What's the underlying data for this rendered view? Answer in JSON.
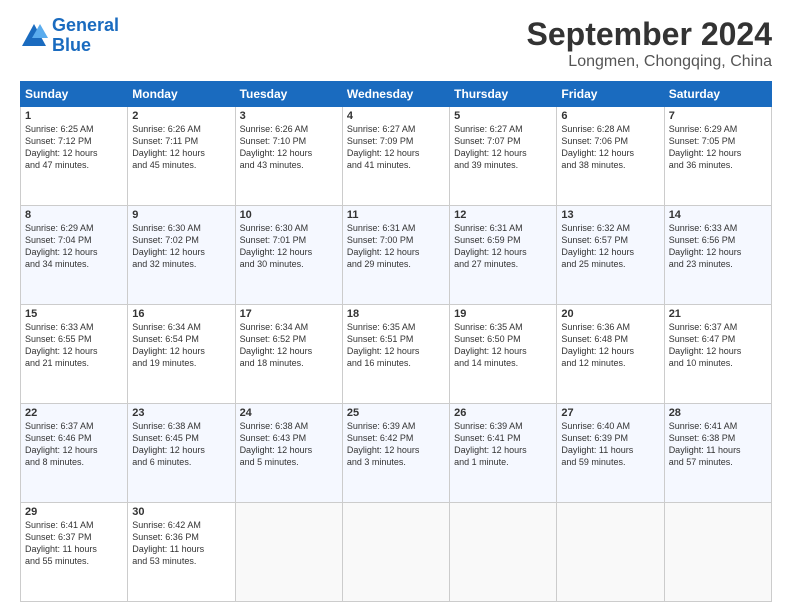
{
  "logo": {
    "line1": "General",
    "line2": "Blue"
  },
  "title": "September 2024",
  "location": "Longmen, Chongqing, China",
  "days_of_week": [
    "Sunday",
    "Monday",
    "Tuesday",
    "Wednesday",
    "Thursday",
    "Friday",
    "Saturday"
  ],
  "weeks": [
    [
      {
        "day": "1",
        "info": "Sunrise: 6:25 AM\nSunset: 7:12 PM\nDaylight: 12 hours\nand 47 minutes."
      },
      {
        "day": "2",
        "info": "Sunrise: 6:26 AM\nSunset: 7:11 PM\nDaylight: 12 hours\nand 45 minutes."
      },
      {
        "day": "3",
        "info": "Sunrise: 6:26 AM\nSunset: 7:10 PM\nDaylight: 12 hours\nand 43 minutes."
      },
      {
        "day": "4",
        "info": "Sunrise: 6:27 AM\nSunset: 7:09 PM\nDaylight: 12 hours\nand 41 minutes."
      },
      {
        "day": "5",
        "info": "Sunrise: 6:27 AM\nSunset: 7:07 PM\nDaylight: 12 hours\nand 39 minutes."
      },
      {
        "day": "6",
        "info": "Sunrise: 6:28 AM\nSunset: 7:06 PM\nDaylight: 12 hours\nand 38 minutes."
      },
      {
        "day": "7",
        "info": "Sunrise: 6:29 AM\nSunset: 7:05 PM\nDaylight: 12 hours\nand 36 minutes."
      }
    ],
    [
      {
        "day": "8",
        "info": "Sunrise: 6:29 AM\nSunset: 7:04 PM\nDaylight: 12 hours\nand 34 minutes."
      },
      {
        "day": "9",
        "info": "Sunrise: 6:30 AM\nSunset: 7:02 PM\nDaylight: 12 hours\nand 32 minutes."
      },
      {
        "day": "10",
        "info": "Sunrise: 6:30 AM\nSunset: 7:01 PM\nDaylight: 12 hours\nand 30 minutes."
      },
      {
        "day": "11",
        "info": "Sunrise: 6:31 AM\nSunset: 7:00 PM\nDaylight: 12 hours\nand 29 minutes."
      },
      {
        "day": "12",
        "info": "Sunrise: 6:31 AM\nSunset: 6:59 PM\nDaylight: 12 hours\nand 27 minutes."
      },
      {
        "day": "13",
        "info": "Sunrise: 6:32 AM\nSunset: 6:57 PM\nDaylight: 12 hours\nand 25 minutes."
      },
      {
        "day": "14",
        "info": "Sunrise: 6:33 AM\nSunset: 6:56 PM\nDaylight: 12 hours\nand 23 minutes."
      }
    ],
    [
      {
        "day": "15",
        "info": "Sunrise: 6:33 AM\nSunset: 6:55 PM\nDaylight: 12 hours\nand 21 minutes."
      },
      {
        "day": "16",
        "info": "Sunrise: 6:34 AM\nSunset: 6:54 PM\nDaylight: 12 hours\nand 19 minutes."
      },
      {
        "day": "17",
        "info": "Sunrise: 6:34 AM\nSunset: 6:52 PM\nDaylight: 12 hours\nand 18 minutes."
      },
      {
        "day": "18",
        "info": "Sunrise: 6:35 AM\nSunset: 6:51 PM\nDaylight: 12 hours\nand 16 minutes."
      },
      {
        "day": "19",
        "info": "Sunrise: 6:35 AM\nSunset: 6:50 PM\nDaylight: 12 hours\nand 14 minutes."
      },
      {
        "day": "20",
        "info": "Sunrise: 6:36 AM\nSunset: 6:48 PM\nDaylight: 12 hours\nand 12 minutes."
      },
      {
        "day": "21",
        "info": "Sunrise: 6:37 AM\nSunset: 6:47 PM\nDaylight: 12 hours\nand 10 minutes."
      }
    ],
    [
      {
        "day": "22",
        "info": "Sunrise: 6:37 AM\nSunset: 6:46 PM\nDaylight: 12 hours\nand 8 minutes."
      },
      {
        "day": "23",
        "info": "Sunrise: 6:38 AM\nSunset: 6:45 PM\nDaylight: 12 hours\nand 6 minutes."
      },
      {
        "day": "24",
        "info": "Sunrise: 6:38 AM\nSunset: 6:43 PM\nDaylight: 12 hours\nand 5 minutes."
      },
      {
        "day": "25",
        "info": "Sunrise: 6:39 AM\nSunset: 6:42 PM\nDaylight: 12 hours\nand 3 minutes."
      },
      {
        "day": "26",
        "info": "Sunrise: 6:39 AM\nSunset: 6:41 PM\nDaylight: 12 hours\nand 1 minute."
      },
      {
        "day": "27",
        "info": "Sunrise: 6:40 AM\nSunset: 6:39 PM\nDaylight: 11 hours\nand 59 minutes."
      },
      {
        "day": "28",
        "info": "Sunrise: 6:41 AM\nSunset: 6:38 PM\nDaylight: 11 hours\nand 57 minutes."
      }
    ],
    [
      {
        "day": "29",
        "info": "Sunrise: 6:41 AM\nSunset: 6:37 PM\nDaylight: 11 hours\nand 55 minutes."
      },
      {
        "day": "30",
        "info": "Sunrise: 6:42 AM\nSunset: 6:36 PM\nDaylight: 11 hours\nand 53 minutes."
      },
      {
        "day": "",
        "info": ""
      },
      {
        "day": "",
        "info": ""
      },
      {
        "day": "",
        "info": ""
      },
      {
        "day": "",
        "info": ""
      },
      {
        "day": "",
        "info": ""
      }
    ]
  ]
}
